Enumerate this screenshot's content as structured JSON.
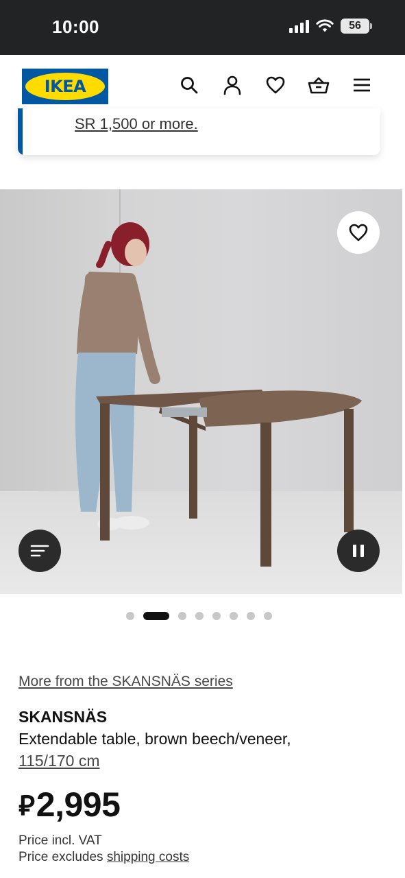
{
  "status_bar": {
    "time": "10:00",
    "battery": "56"
  },
  "header": {
    "logo_text": "IKEA",
    "icons": [
      "search-icon",
      "account-icon",
      "heart-icon",
      "basket-icon",
      "menu-icon"
    ]
  },
  "banner": {
    "link_text": "SR 1,500 or more."
  },
  "media": {
    "controls": [
      "favorite-heart-icon",
      "details-menu-icon",
      "pause-icon"
    ],
    "carousel": {
      "total": 8,
      "active_index": 1
    }
  },
  "product": {
    "series_link": "More from the SKANSNÄS series",
    "name": "SKANSNÄS",
    "description": "Extendable table, brown beech/veneer,",
    "size": "115/170 cm",
    "currency_symbol": "⃁",
    "price": "2,995",
    "vat_note": "Price incl. VAT",
    "shipping_prefix": "Price excludes",
    "shipping_link": "shipping costs"
  },
  "colors": {
    "ikea_blue": "#0058a3",
    "ikea_yellow": "#ffdb00",
    "status_bar_bg": "#222325",
    "control_dark": "#2b2b2b"
  }
}
